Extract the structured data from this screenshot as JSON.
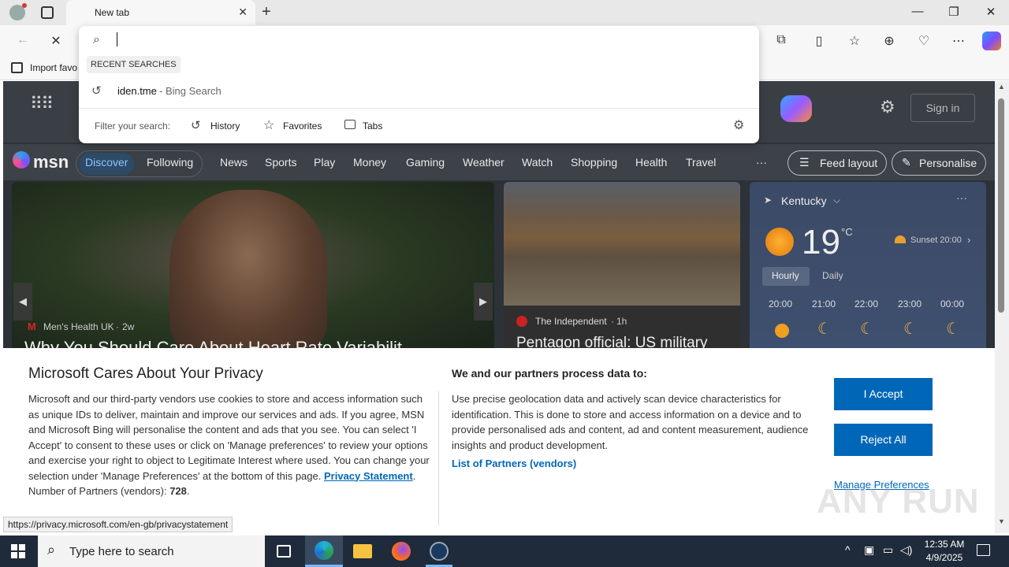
{
  "browser": {
    "tab_title": "New tab",
    "favorites_bar_item": "Import favo"
  },
  "omnibox": {
    "section_label": "RECENT SEARCHES",
    "recent_item": "iden.tme",
    "recent_item_suffix": " - Bing Search",
    "filter_label": "Filter your search:",
    "filters": [
      "History",
      "Favorites",
      "Tabs"
    ]
  },
  "msn": {
    "logo": "msn",
    "sign_in": "Sign in",
    "nav_active": "Discover",
    "nav_items": [
      "Following",
      "News",
      "Sports",
      "Play",
      "Money",
      "Gaming",
      "Weather",
      "Watch",
      "Shopping",
      "Health",
      "Travel"
    ],
    "more": "···",
    "feed_layout": "Feed layout",
    "personalise": "Personalise",
    "hero": {
      "source_letter": "M",
      "source": "Men's Health UK",
      "age": "2w",
      "headline": "Why You Should Care About Heart Rate Variabilit"
    },
    "card2": {
      "source": "The Independent",
      "age": "1h",
      "headline": "Pentagon official: US military"
    },
    "weather": {
      "location": "Kentucky",
      "temp": "19",
      "unit": "°C",
      "sunset": "Sunset 20:00",
      "tabs": [
        "Hourly",
        "Daily"
      ],
      "hours": [
        "20:00",
        "21:00",
        "22:00",
        "23:00",
        "00:00"
      ]
    }
  },
  "privacy": {
    "title": "Microsoft Cares About Your Privacy",
    "body": "Microsoft and our third-party vendors use cookies to store and access information such as unique IDs to deliver, maintain and improve our services and ads. If you agree, MSN and Microsoft Bing will personalise the content and ads that you see. You can select 'I Accept' to consent to these uses or click on 'Manage preferences' to review your options and exercise your right to object to Legitimate Interest where used. You can change your selection under 'Manage Preferences' at the bottom of this page.",
    "privacy_link": "Privacy Statement",
    "partners_label": "Number of Partners (vendors):",
    "partners_count": "728",
    "right_title": "We and our partners process data to:",
    "right_body": "Use precise geolocation data and actively scan device characteristics for identification. This is done to store and access information on a device and to provide personalised ads and content, ad and content measurement, audience insights and product development.",
    "partners_link": "List of Partners (vendors)",
    "accept": "I Accept",
    "reject": "Reject All",
    "manage": "Manage Preferences"
  },
  "status_url": "https://privacy.microsoft.com/en-gb/privacystatement",
  "taskbar": {
    "search_placeholder": "Type here to search",
    "time": "12:35 AM",
    "date": "4/9/2025"
  },
  "watermark": "ANY RUN"
}
